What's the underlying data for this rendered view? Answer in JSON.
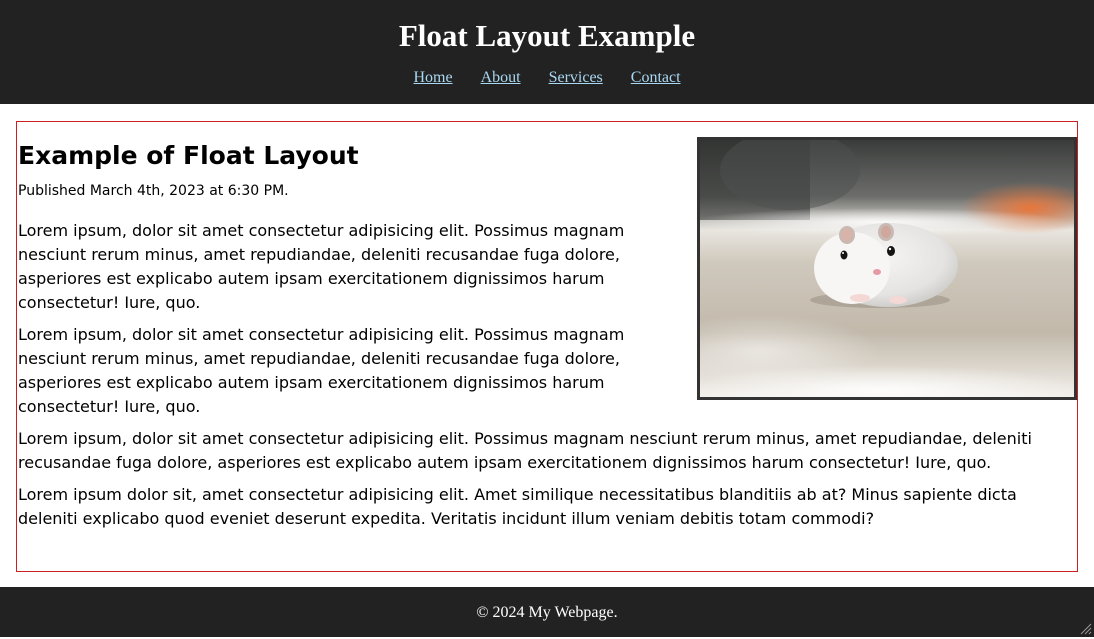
{
  "header": {
    "title": "Float Layout Example",
    "nav": [
      "Home",
      "About",
      "Services",
      "Contact"
    ]
  },
  "article": {
    "title": "Example of Float Layout",
    "published": "Published March 4th, 2023 at 6:30 PM.",
    "paragraphs": [
      "Lorem ipsum, dolor sit amet consectetur adipisicing elit. Possimus magnam nesciunt rerum minus, amet repudiandae, deleniti recusandae fuga dolore, asperiores est explicabo autem ipsam exercitationem dignissimos harum consectetur! Iure, quo.",
      "Lorem ipsum, dolor sit amet consectetur adipisicing elit. Possimus magnam nesciunt rerum minus, amet repudiandae, deleniti recusandae fuga dolore, asperiores est explicabo autem ipsam exercitationem dignissimos harum consectetur! Iure, quo.",
      "Lorem ipsum, dolor sit amet consectetur adipisicing elit. Possimus magnam nesciunt rerum minus, amet repudiandae, deleniti recusandae fuga dolore, asperiores est explicabo autem ipsam exercitationem dignissimos harum consectetur! Iure, quo.",
      "Lorem ipsum dolor sit, amet consectetur adipisicing elit. Amet similique necessitatibus blanditiis ab at? Minus sapiente dicta deleniti explicabo quod eveniet deserunt expedita. Veritatis incidunt illum veniam debitis totam commodi?"
    ],
    "image_icon": "hamster-photo"
  },
  "footer": {
    "text": "© 2024 My Webpage."
  },
  "colors": {
    "header_bg": "#222222",
    "nav_link": "#a9d8f2",
    "article_border": "#cc2020",
    "image_border": "#333333"
  }
}
